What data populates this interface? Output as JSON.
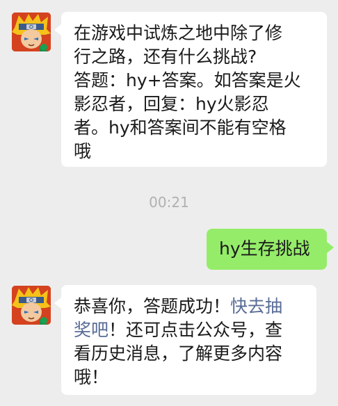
{
  "messages": [
    {
      "sender": "official-account",
      "lines": [
        "在游戏中试炼之地中除了修",
        "行之路，还有什么挑战?",
        "答题：hy+答案。如答案是火",
        "影忍者，回复：hy火影忍",
        "者。hy和答案间不能有空格",
        "哦"
      ]
    },
    {
      "sender": "me",
      "text": "hy生存挑战"
    },
    {
      "sender": "official-account",
      "line1_plain": "恭喜你，答题成功！",
      "line1_link": "快去抽",
      "line2_link": "奖吧",
      "line2_plain": "！还可点击公众号，查",
      "line3": "看历史消息，了解更多内容",
      "line4": "哦！"
    }
  ],
  "timestamp": "00:21",
  "colors": {
    "background": "#ededed",
    "incoming_bubble": "#ffffff",
    "outgoing_bubble": "#95ec69",
    "link": "#576b95"
  },
  "icons": {
    "avatar": "naruto-avatar-icon"
  }
}
